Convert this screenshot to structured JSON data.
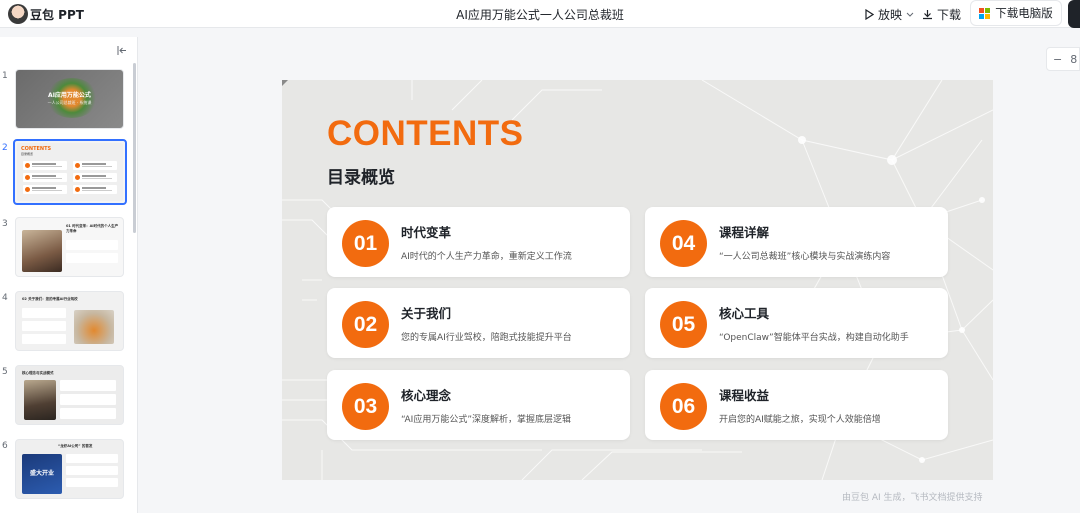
{
  "app": {
    "name": "豆包 PPT",
    "logo_icon": "avatar-logo"
  },
  "document": {
    "title": "AI应用万能公式一人公司总裁班"
  },
  "toolbar": {
    "play_label": "放映",
    "download_label": "下载",
    "desktop_label": "下载电脑版",
    "zoom_value": "8"
  },
  "sidebar": {
    "thumbnails": [
      {
        "number": "1",
        "title": "AI应用万能公式",
        "subtitle": "一人公司总裁班 · 系统课"
      },
      {
        "number": "2",
        "title": "CONTENTS",
        "subtitle": "目录概览",
        "active": true
      },
      {
        "number": "3",
        "title": "01 时代变革：AI时代的个人生产力革命"
      },
      {
        "number": "4",
        "title": "02 关于我们：您的专属AI行业驾校"
      },
      {
        "number": "5",
        "title": "核心理念与实战模式"
      },
      {
        "number": "6",
        "title": "“龙虾AI公司” 的首发",
        "badge": "盛大开业"
      }
    ]
  },
  "slide": {
    "heading": "CONTENTS",
    "subheading": "目录概览",
    "items": [
      {
        "num": "01",
        "title": "时代变革",
        "desc": "AI时代的个人生产力革命，重新定义工作流"
      },
      {
        "num": "02",
        "title": "关于我们",
        "desc": "您的专属AI行业驾校，陪跑式技能提升平台"
      },
      {
        "num": "03",
        "title": "核心理念",
        "desc": "“AI应用万能公式”深度解析，掌握底层逻辑"
      },
      {
        "num": "04",
        "title": "课程详解",
        "desc": "“一人公司总裁班”核心模块与实战演练内容"
      },
      {
        "num": "05",
        "title": "核心工具",
        "desc": "“OpenClaw”智能体平台实战，构建自动化助手"
      },
      {
        "num": "06",
        "title": "课程收益",
        "desc": "开启您的AI赋能之旅，实现个人效能倍增"
      }
    ]
  },
  "footer": {
    "note": "由豆包 AI 生成，飞书文档提供支持"
  },
  "colors": {
    "accent": "#f26b0f",
    "selection": "#3370ff",
    "slide_bg": "#e7e7e5"
  }
}
